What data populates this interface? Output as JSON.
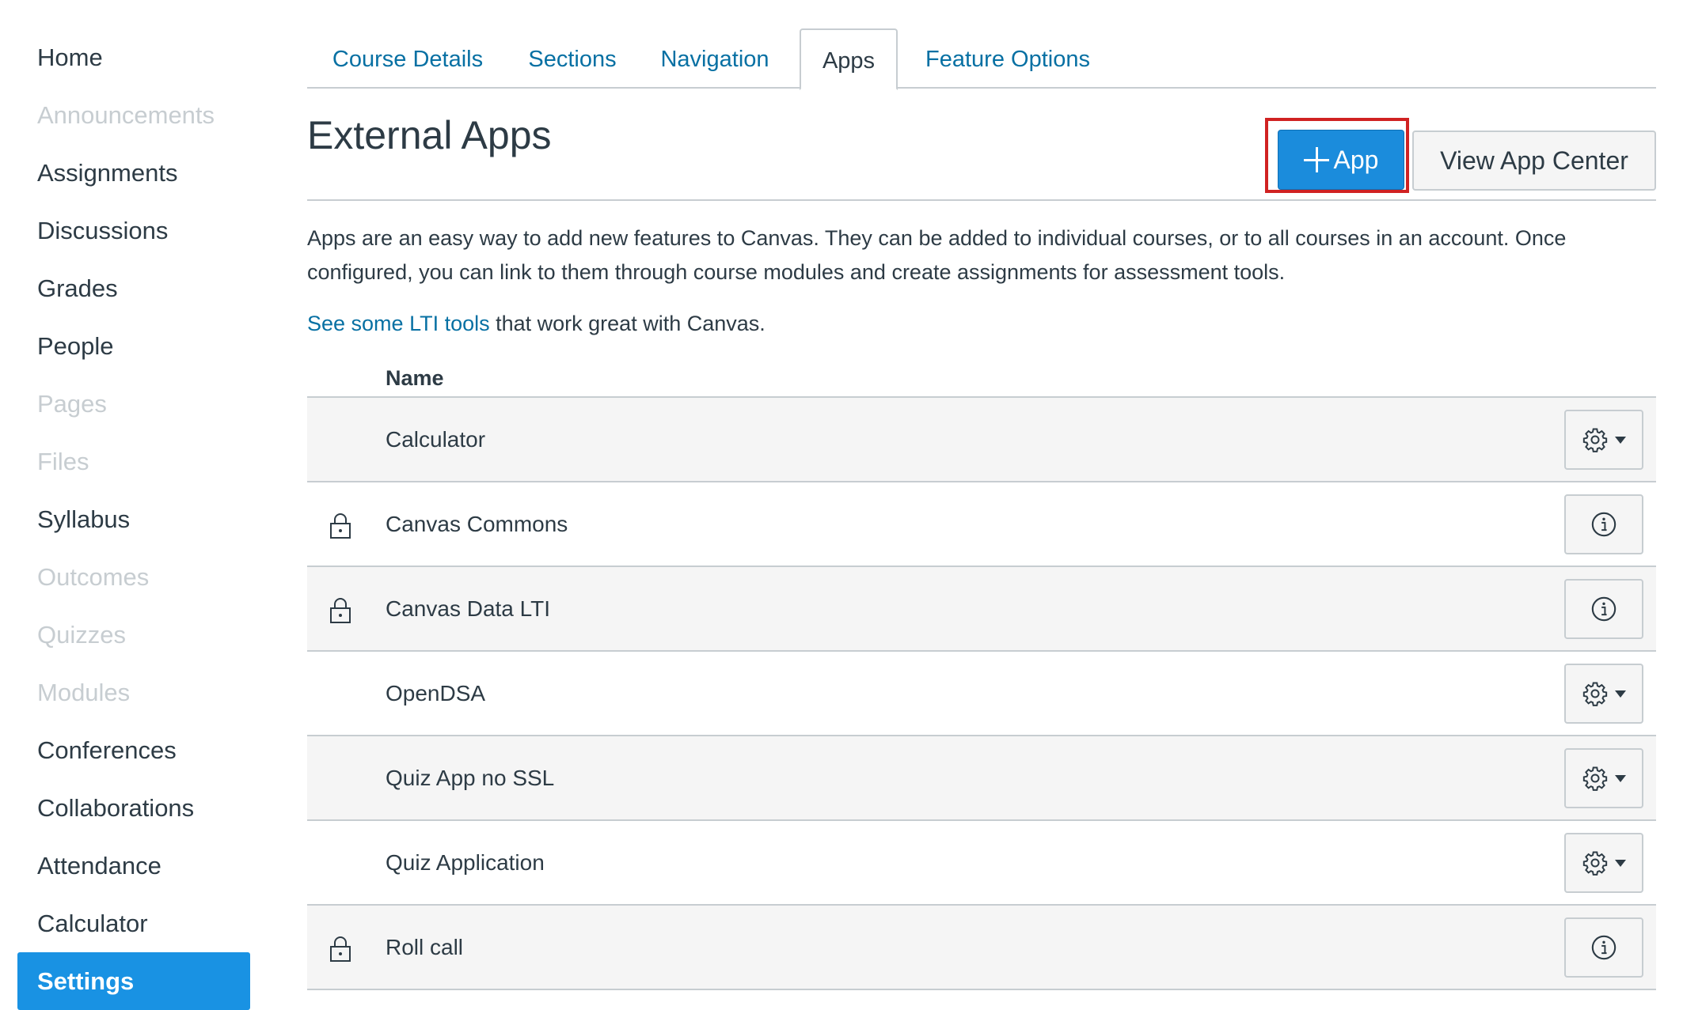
{
  "sidebar": {
    "items": [
      {
        "label": "Home",
        "state": "enabled"
      },
      {
        "label": "Announcements",
        "state": "disabled"
      },
      {
        "label": "Assignments",
        "state": "enabled"
      },
      {
        "label": "Discussions",
        "state": "enabled"
      },
      {
        "label": "Grades",
        "state": "enabled"
      },
      {
        "label": "People",
        "state": "enabled"
      },
      {
        "label": "Pages",
        "state": "disabled"
      },
      {
        "label": "Files",
        "state": "disabled"
      },
      {
        "label": "Syllabus",
        "state": "enabled"
      },
      {
        "label": "Outcomes",
        "state": "disabled"
      },
      {
        "label": "Quizzes",
        "state": "disabled"
      },
      {
        "label": "Modules",
        "state": "disabled"
      },
      {
        "label": "Conferences",
        "state": "enabled"
      },
      {
        "label": "Collaborations",
        "state": "enabled"
      },
      {
        "label": "Attendance",
        "state": "enabled"
      },
      {
        "label": "Calculator",
        "state": "enabled"
      },
      {
        "label": "Settings",
        "state": "active"
      }
    ]
  },
  "tabs": [
    {
      "label": "Course Details"
    },
    {
      "label": "Sections"
    },
    {
      "label": "Navigation"
    },
    {
      "label": "Apps",
      "active": true
    },
    {
      "label": "Feature Options"
    }
  ],
  "header": {
    "title": "External Apps",
    "add_app_label": "App",
    "view_app_center_label": "View App Center"
  },
  "description": "Apps are an easy way to add new features to Canvas. They can be added to individual courses, or to all courses in an account. Once configured, you can link to them through course modules and create assignments for assessment tools.",
  "lti": {
    "link_text": "See some LTI tools",
    "suffix": " that work great with Canvas."
  },
  "table": {
    "column_header": "Name",
    "rows": [
      {
        "name": "Calculator",
        "locked": false,
        "action_icon": "gear-icon"
      },
      {
        "name": "Canvas Commons",
        "locked": true,
        "action_icon": "info-icon"
      },
      {
        "name": "Canvas Data LTI",
        "locked": true,
        "action_icon": "info-icon"
      },
      {
        "name": "OpenDSA",
        "locked": false,
        "action_icon": "gear-icon"
      },
      {
        "name": "Quiz App no SSL",
        "locked": false,
        "action_icon": "gear-icon"
      },
      {
        "name": "Quiz Application",
        "locked": false,
        "action_icon": "gear-icon"
      },
      {
        "name": "Roll call",
        "locked": true,
        "action_icon": "info-icon"
      }
    ]
  },
  "colors": {
    "link": "#0770a3",
    "primary": "#1b8cdc",
    "active_nav": "#1992e3",
    "highlight": "#d02222",
    "disabled_text": "#c7cdd1"
  }
}
